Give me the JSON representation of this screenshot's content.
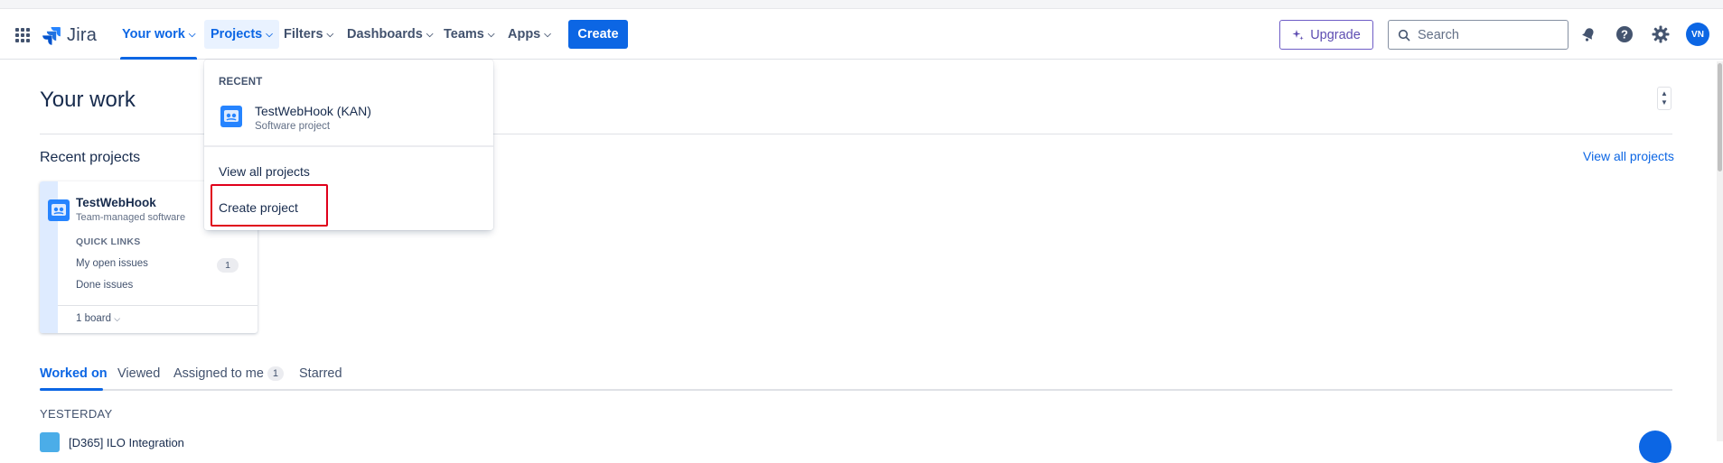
{
  "header": {
    "app_name": "Jira",
    "nav": [
      {
        "label": "Your work"
      },
      {
        "label": "Projects"
      },
      {
        "label": "Filters"
      },
      {
        "label": "Dashboards"
      },
      {
        "label": "Teams"
      },
      {
        "label": "Apps"
      }
    ],
    "create_label": "Create",
    "upgrade_label": "Upgrade",
    "search_placeholder": "Search",
    "avatar_initials": "VN",
    "accent_color": "#0c66e4"
  },
  "main": {
    "title": "Your work",
    "recent_projects_title": "Recent projects",
    "view_all_projects": "View all projects",
    "project_card": {
      "name": "TestWebHook",
      "type": "Team-managed software",
      "quick_links_heading": "QUICK LINKS",
      "links": [
        {
          "label": "My open issues",
          "count": "1"
        },
        {
          "label": "Done issues"
        }
      ],
      "board_label": "1 board"
    },
    "tabs": [
      {
        "label": "Worked on"
      },
      {
        "label": "Viewed"
      },
      {
        "label": "Assigned to me",
        "badge": "1"
      },
      {
        "label": "Starred"
      }
    ],
    "group_heading": "YESTERDAY",
    "items": [
      {
        "title": "[D365] ILO Integration"
      }
    ]
  },
  "projects_dropdown": {
    "recent_heading": "RECENT",
    "recent": [
      {
        "name": "TestWebHook (KAN)",
        "type": "Software project"
      }
    ],
    "view_all": "View all projects",
    "create": "Create project"
  }
}
